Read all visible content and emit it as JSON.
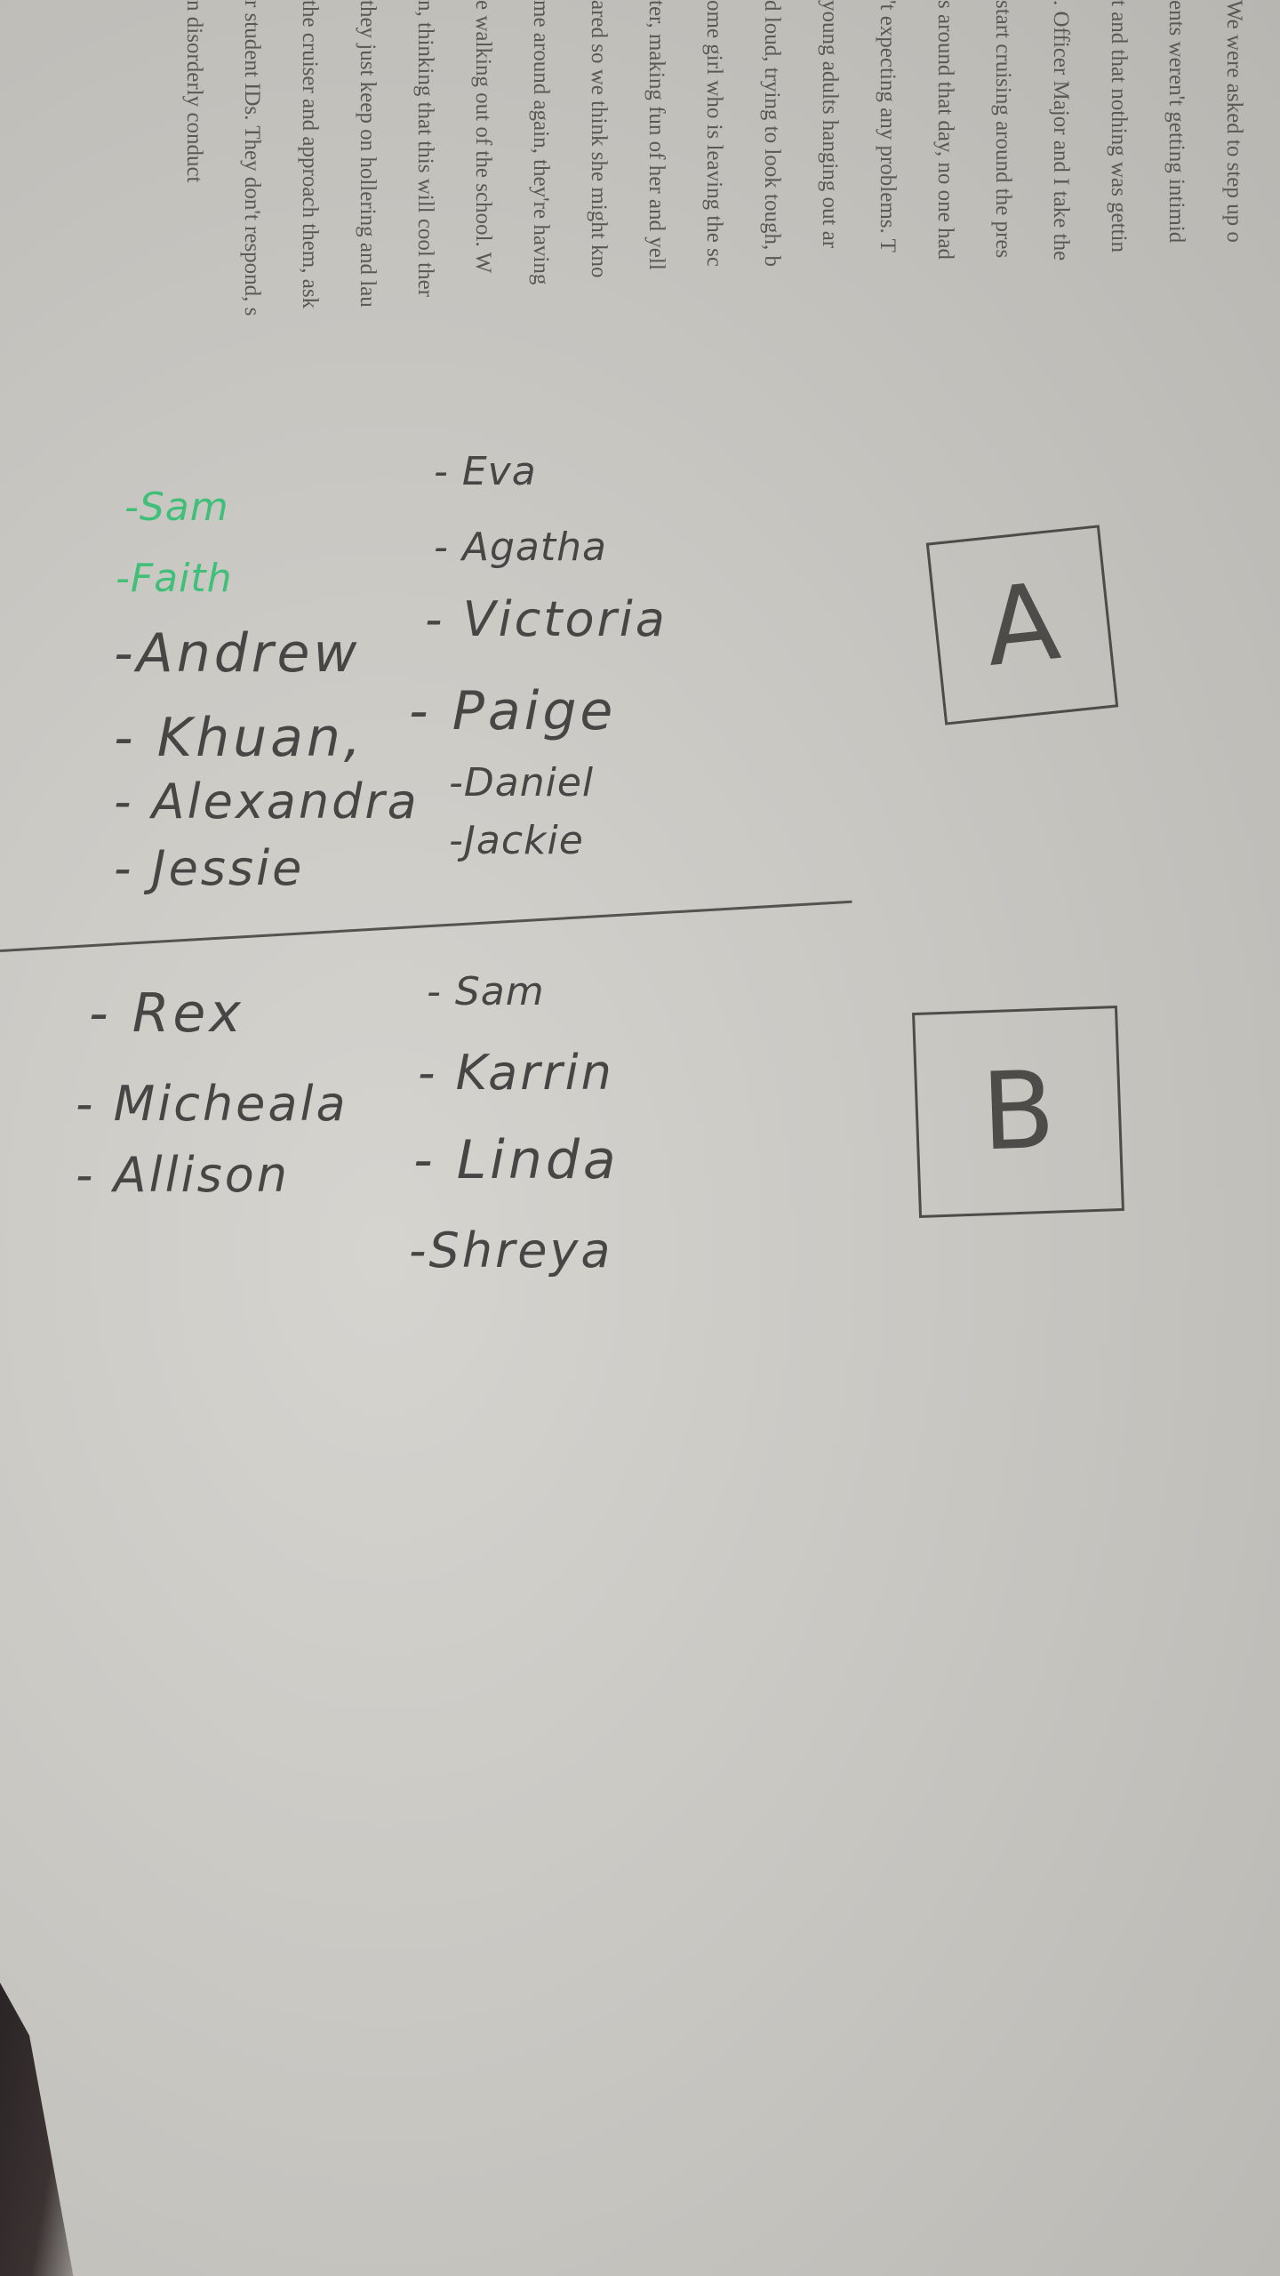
{
  "printed_text": [
    "We were asked to step up o",
    "ents weren't getting intimid",
    "t and that nothing was gettin",
    ". Officer Major and I take the",
    "start cruising around the pres",
    "s around that day, no one had",
    "'t expecting any problems. T",
    "young adults hanging out ar",
    "d loud, trying to look tough, b",
    "ome girl who is leaving the sc",
    "ter, making fun of her and yell",
    "ared so we think she might kno",
    "me around again, they're having",
    "e walking out of the school. W",
    "n, thinking that this will cool ther",
    "they just keep on hollering and lau",
    "the cruiser and approach them, ask",
    "r student IDs. They don't respond, s",
    "n disorderly conduct"
  ],
  "group_a": {
    "label": "A",
    "left_column": [
      "-Sam",
      "-Faith",
      "-Andrew",
      "- Khuan,",
      "- Alexandra",
      "- Jessie"
    ],
    "right_column": [
      "- Eva",
      "- Agatha",
      "- Victoria",
      "- Paige",
      "-Daniel",
      "-Jackie"
    ]
  },
  "group_b": {
    "label": "B",
    "left_column": [
      "- Rex",
      "- Micheala",
      "- Allison"
    ],
    "right_column": [
      "- Sam",
      "- Karrin",
      "- Linda",
      "-Shreya"
    ]
  },
  "colors": {
    "pencil": "#474645",
    "green_ink": "#3fbf77",
    "paper": "#d0cec9"
  }
}
